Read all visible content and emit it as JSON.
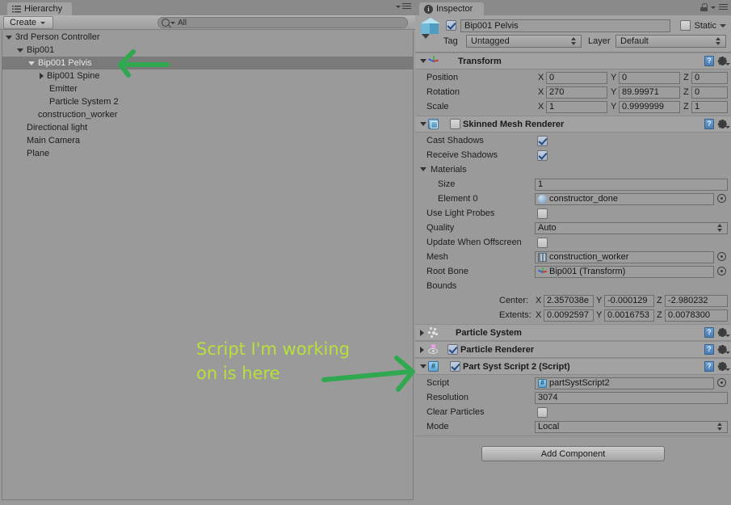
{
  "hierarchy": {
    "tab_label": "Hierarchy",
    "tab_icon": "list-icon",
    "create_label": "Create",
    "search_placeholder": "All",
    "search_value": "All",
    "items": [
      {
        "label": "3rd Person Controller",
        "depth": 0,
        "foldout": "open",
        "selected": false
      },
      {
        "label": "Bip001",
        "depth": 1,
        "foldout": "open",
        "selected": false
      },
      {
        "label": "Bip001 Pelvis",
        "depth": 2,
        "foldout": "open",
        "selected": true
      },
      {
        "label": "Bip001 Spine",
        "depth": 3,
        "foldout": "closed",
        "selected": false
      },
      {
        "label": "Emitter",
        "depth": 3,
        "foldout": "none",
        "selected": false
      },
      {
        "label": "Particle System 2",
        "depth": 3,
        "foldout": "none",
        "selected": false
      },
      {
        "label": "construction_worker",
        "depth": 2,
        "foldout": "none",
        "selected": false
      },
      {
        "label": "Directional light",
        "depth": 1,
        "foldout": "none",
        "selected": false
      },
      {
        "label": "Main Camera",
        "depth": 1,
        "foldout": "none",
        "selected": false
      },
      {
        "label": "Plane",
        "depth": 1,
        "foldout": "none",
        "selected": false
      }
    ]
  },
  "inspector": {
    "tab_label": "Inspector",
    "gameobject": {
      "name": "Bip001 Pelvis",
      "enabled": true,
      "static_label": "Static",
      "static_checked": false,
      "tag_label": "Tag",
      "tag_value": "Untagged",
      "layer_label": "Layer",
      "layer_value": "Default"
    },
    "transform": {
      "title": "Transform",
      "expanded": true,
      "rows": [
        {
          "label": "Position",
          "x": "0",
          "y": "0",
          "z": "0"
        },
        {
          "label": "Rotation",
          "x": "270",
          "y": "89.99971",
          "z": "0"
        },
        {
          "label": "Scale",
          "x": "1",
          "y": "0.9999999",
          "z": "1"
        }
      ],
      "axis_x": "X",
      "axis_y": "Y",
      "axis_z": "Z"
    },
    "skinned_mesh_renderer": {
      "title": "Skinned Mesh Renderer",
      "expanded": true,
      "enabled": false,
      "cast_shadows_label": "Cast Shadows",
      "cast_shadows": true,
      "receive_shadows_label": "Receive Shadows",
      "receive_shadows": true,
      "materials_label": "Materials",
      "size_label": "Size",
      "size_value": "1",
      "element0_label": "Element 0",
      "element0_value": "constructor_done",
      "use_light_probes_label": "Use Light Probes",
      "use_light_probes": false,
      "quality_label": "Quality",
      "quality_value": "Auto",
      "update_offscreen_label": "Update When Offscreen",
      "update_offscreen": false,
      "mesh_label": "Mesh",
      "mesh_value": "construction_worker",
      "root_bone_label": "Root Bone",
      "root_bone_value": "Bip001 (Transform)",
      "bounds_label": "Bounds",
      "center_label": "Center:",
      "center_x": "2.357038e",
      "center_y": "-0.000129",
      "center_z": "-2.980232",
      "extents_label": "Extents:",
      "extents_x": "0.0092597",
      "extents_y": "0.0016753",
      "extents_z": "0.0078300",
      "axis_x": "X",
      "axis_y": "Y",
      "axis_z": "Z"
    },
    "particle_system": {
      "title": "Particle System",
      "expanded": false
    },
    "particle_renderer": {
      "title": "Particle Renderer",
      "expanded": false,
      "enabled": true
    },
    "part_syst_script": {
      "title": "Part Syst Script 2 (Script)",
      "expanded": true,
      "enabled": true,
      "script_label": "Script",
      "script_value": "partSystScript2",
      "resolution_label": "Resolution",
      "resolution_value": "3074",
      "clear_particles_label": "Clear Particles",
      "clear_particles": false,
      "mode_label": "Mode",
      "mode_value": "Local"
    },
    "add_component_label": "Add Component"
  },
  "annotations": {
    "note_line1": "Script I'm working",
    "note_line2": "on is here",
    "note_color": "#b7e13a",
    "arrow_color": "#2fa84f"
  }
}
